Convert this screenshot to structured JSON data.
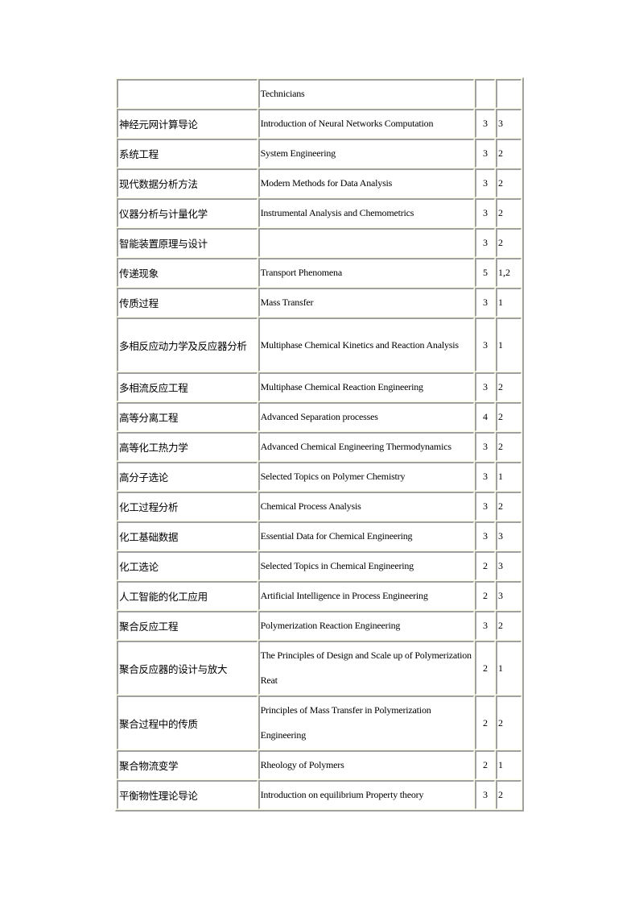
{
  "table": {
    "rows": [
      {
        "zh": "",
        "en": "Technicians",
        "credits": "",
        "semester": "",
        "lines": 1
      },
      {
        "zh": "神经元网计算导论",
        "en": "Introduction of Neural Networks Computation",
        "credits": "3",
        "semester": "3",
        "lines": 1
      },
      {
        "zh": "系统工程",
        "en": "System Engineering",
        "credits": "3",
        "semester": "2",
        "lines": 1
      },
      {
        "zh": "现代数据分析方法",
        "en": "Modern Methods for Data Analysis",
        "credits": "3",
        "semester": "2",
        "lines": 1
      },
      {
        "zh": "仪器分析与计量化学",
        "en": "Instrumental  Analysis and Chemometrics",
        "credits": "3",
        "semester": "2",
        "lines": 1
      },
      {
        "zh": "智能装置原理与设计",
        "en": "",
        "credits": "3",
        "semester": "2",
        "lines": 1
      },
      {
        "zh": "传递现象",
        "en": "Transport Phenomena",
        "credits": "5",
        "semester": "1,2",
        "lines": 1
      },
      {
        "zh": "传质过程",
        "en": "Mass Transfer",
        "credits": "3",
        "semester": "1",
        "lines": 1
      },
      {
        "zh": "多相反应动力学及反应器分析",
        "en": "Multiphase  Chemical  Kinetics  and Reaction Analysis",
        "credits": "3",
        "semester": "1",
        "lines": 2
      },
      {
        "zh": "多相流反应工程",
        "en": "Multiphase  Chemical  Reaction  Engineering",
        "credits": "3",
        "semester": "2",
        "lines": 1
      },
      {
        "zh": "高等分离工程",
        "en": "Advanced Separation processes",
        "credits": "4",
        "semester": "2",
        "lines": 1
      },
      {
        "zh": "高等化工热力学",
        "en": "Advanced  Chemical  Engineering  Thermodynamics",
        "credits": "3",
        "semester": "2",
        "lines": 1
      },
      {
        "zh": "高分子选论",
        "en": "Selected  Topics on Polymer  Chemistry",
        "credits": "3",
        "semester": "1",
        "lines": 1
      },
      {
        "zh": "化工过程分析",
        "en": "Chemical  Process Analysis",
        "credits": "3",
        "semester": "2",
        "lines": 1
      },
      {
        "zh": "化工基础数据",
        "en": "Essential  Data  for  Chemical  Engineering",
        "credits": "3",
        "semester": "3",
        "lines": 1
      },
      {
        "zh": "化工选论",
        "en": "Selected  Topics  in  Chemical  Engineering",
        "credits": "2",
        "semester": "3",
        "lines": 1
      },
      {
        "zh": "人工智能的化工应用",
        "en": "Artificial  Intelligence  in Process Engineering",
        "credits": "2",
        "semester": "3",
        "lines": 1
      },
      {
        "zh": "聚合反应工程",
        "en": "Polymerization  Reaction  Engineering",
        "credits": "3",
        "semester": "2",
        "lines": 1
      },
      {
        "zh": "聚合反应器的设计与放大",
        "en": "The Principles  of Design and Scale up of Polymerization  Reat",
        "credits": "2",
        "semester": "1",
        "lines": 2
      },
      {
        "zh": "聚合过程中的传质",
        "en": "Principles  of Mass Transfer in Polymerization Engineering",
        "credits": "2",
        "semester": "2",
        "lines": 2
      },
      {
        "zh": "聚合物流变学",
        "en": "Rheology of Polymers",
        "credits": "2",
        "semester": "1",
        "lines": 1
      },
      {
        "zh": "平衡物性理论导论",
        "en": "Introduction on equilibrium  Property theory",
        "credits": "3",
        "semester": "2",
        "lines": 1
      }
    ]
  }
}
